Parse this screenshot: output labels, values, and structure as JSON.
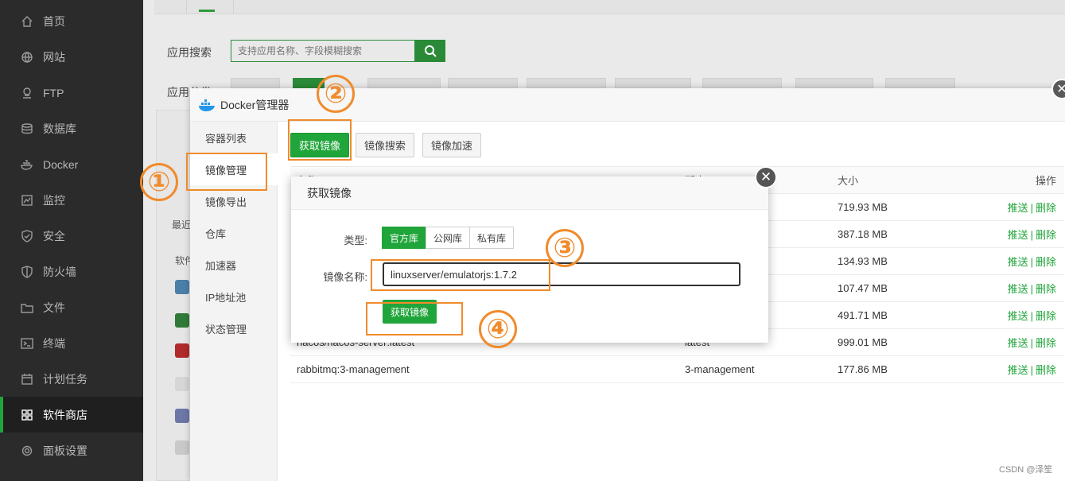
{
  "sidebar": {
    "items": [
      {
        "label": "首页",
        "icon": "home-icon",
        "active": false
      },
      {
        "label": "网站",
        "icon": "globe-icon",
        "active": false
      },
      {
        "label": "FTP",
        "icon": "ftp-icon",
        "active": false
      },
      {
        "label": "数据库",
        "icon": "database-icon",
        "active": false
      },
      {
        "label": "Docker",
        "icon": "docker-icon",
        "active": false
      },
      {
        "label": "监控",
        "icon": "monitor-icon",
        "active": false
      },
      {
        "label": "安全",
        "icon": "shield-icon",
        "active": false
      },
      {
        "label": "防火墙",
        "icon": "firewall-icon",
        "active": false
      },
      {
        "label": "文件",
        "icon": "folder-icon",
        "active": false
      },
      {
        "label": "终端",
        "icon": "terminal-icon",
        "active": false
      },
      {
        "label": "计划任务",
        "icon": "calendar-icon",
        "active": false
      },
      {
        "label": "软件商店",
        "icon": "grid-icon",
        "active": true
      },
      {
        "label": "面板设置",
        "icon": "gear-icon",
        "active": false
      }
    ]
  },
  "background": {
    "search_label": "应用搜索",
    "search_placeholder": "支持应用名称、字段模糊搜索",
    "category_label": "应用分类",
    "recent_label": "最近",
    "software_label": "软件"
  },
  "docker_manager": {
    "title": "Docker管理器",
    "nav": [
      "容器列表",
      "镜像管理",
      "镜像导出",
      "仓库",
      "加速器",
      "IP地址池",
      "状态管理"
    ],
    "active_nav": "镜像管理",
    "toolbar": {
      "get_image": "获取镜像",
      "search_image": "镜像搜索",
      "accelerate": "镜像加速"
    },
    "table": {
      "headers": {
        "name": "名称",
        "tag": "版本",
        "size": "大小",
        "ops": "操作"
      },
      "rows": [
        {
          "name": "",
          "tag": "",
          "size": "719.93 MB"
        },
        {
          "name": "",
          "tag": "",
          "size": "387.18 MB"
        },
        {
          "name": "",
          "tag": "",
          "size": "134.93 MB"
        },
        {
          "name": "",
          "tag": "",
          "size": "107.47 MB"
        },
        {
          "name": "",
          "tag": "",
          "size": "491.71 MB"
        },
        {
          "name": "nacos/nacos-server:latest",
          "tag": "latest",
          "size": "999.01 MB"
        },
        {
          "name": "rabbitmq:3-management",
          "tag": "3-management",
          "size": "177.86 MB"
        }
      ],
      "op_push": "推送",
      "op_sep": "|",
      "op_delete": "删除"
    }
  },
  "dialog": {
    "title": "获取镜像",
    "type_label": "类型:",
    "types": [
      "官方库",
      "公网库",
      "私有库"
    ],
    "active_type": "官方库",
    "name_label": "镜像名称:",
    "name_value": "linuxserver/emulatorjs:1.7.2",
    "submit": "获取镜像"
  },
  "annotations": {
    "step1": "①",
    "step2": "②",
    "step3": "③",
    "step4": "④",
    "color": "#f08b2c"
  },
  "watermark": "CSDN @泽笙",
  "colors": {
    "accent": "#20a53a",
    "sidebar": "#2b2b2b"
  }
}
